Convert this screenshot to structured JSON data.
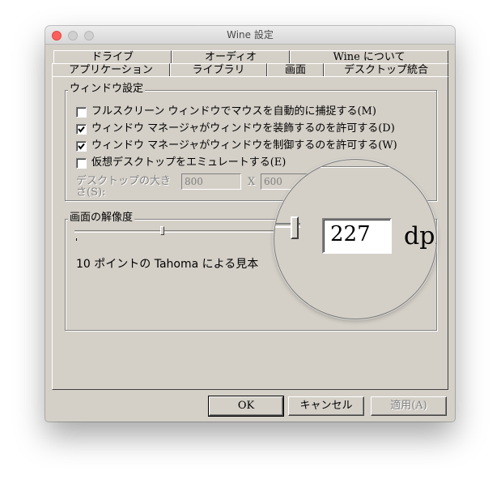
{
  "window": {
    "title": "Wine 設定"
  },
  "tabs": {
    "row1": [
      {
        "label": "ドライブ"
      },
      {
        "label": "オーディオ"
      },
      {
        "label": "Wine について"
      }
    ],
    "row2": [
      {
        "label": "アプリケーション"
      },
      {
        "label": "ライブラリ"
      },
      {
        "label": "画面",
        "active": true
      },
      {
        "label": "デスクトップ統合"
      }
    ]
  },
  "window_settings": {
    "legend": "ウィンドウ設定",
    "options": [
      {
        "label": "フルスクリーン ウィンドウでマウスを自動的に捕捉する(M)",
        "checked": false
      },
      {
        "label": "ウィンドウ マネージャがウィンドウを装飾するのを許可する(D)",
        "checked": true
      },
      {
        "label": "ウィンドウ マネージャがウィンドウを制御するのを許可する(W)",
        "checked": true
      },
      {
        "label": "仮想デスクトップをエミュレートする(E)",
        "checked": false
      }
    ],
    "desktop_size_label": "デスクトップの大きさ(S):",
    "desktop_width": "800",
    "x_separator": "X",
    "desktop_height": "600"
  },
  "resolution": {
    "legend": "画面の解像度",
    "dpi_value": "227",
    "dpi_unit": "dpi",
    "sample_text": "10 ポイントの Tahoma による見本"
  },
  "buttons": {
    "ok": "OK",
    "cancel": "キャンセル",
    "apply": "適用(A)"
  },
  "colors": {
    "dialog_bg": "#d4d0c8",
    "close_button": "#fc605c"
  }
}
